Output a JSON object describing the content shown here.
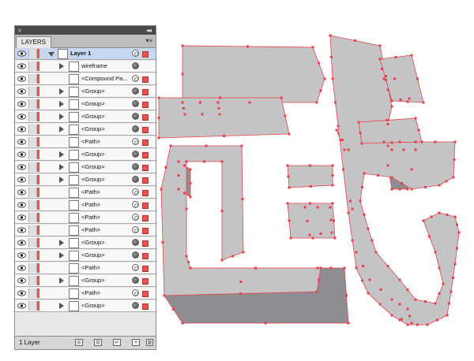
{
  "panel": {
    "tab_label": "LAYERS",
    "menu_icon": "panel-menu-icon",
    "collapse_label": "◂◂",
    "close_label": "x",
    "footer_count": "1 Layer"
  },
  "layers": [
    {
      "label": "Layer 1",
      "level": 0,
      "expand": "down",
      "selected": true,
      "target": "ring",
      "square": "filled"
    },
    {
      "label": "wireframe",
      "level": 1,
      "expand": "right",
      "selected": false,
      "target": "filled",
      "square": "none"
    },
    {
      "label": "<Compound Pa...",
      "level": 1,
      "expand": "none",
      "selected": false,
      "target": "ring",
      "square": "filled"
    },
    {
      "label": "<Group>",
      "level": 1,
      "expand": "right",
      "selected": false,
      "target": "filled",
      "square": "filled"
    },
    {
      "label": "<Group>",
      "level": 1,
      "expand": "right",
      "selected": false,
      "target": "filled",
      "square": "filled"
    },
    {
      "label": "<Group>",
      "level": 1,
      "expand": "right",
      "selected": false,
      "target": "filled",
      "square": "filled"
    },
    {
      "label": "<Group>",
      "level": 1,
      "expand": "right",
      "selected": false,
      "target": "filled",
      "square": "filled"
    },
    {
      "label": "<Path>",
      "level": 1,
      "expand": "none",
      "selected": false,
      "target": "ring",
      "square": "filled"
    },
    {
      "label": "<Group>",
      "level": 1,
      "expand": "right",
      "selected": false,
      "target": "filled",
      "square": "filled"
    },
    {
      "label": "<Group>",
      "level": 1,
      "expand": "right",
      "selected": false,
      "target": "filled",
      "square": "filled"
    },
    {
      "label": "<Group>",
      "level": 1,
      "expand": "right",
      "selected": false,
      "target": "filled",
      "square": "filled"
    },
    {
      "label": "<Path>",
      "level": 1,
      "expand": "none",
      "selected": false,
      "target": "ring",
      "square": "filled"
    },
    {
      "label": "<Path>",
      "level": 1,
      "expand": "none",
      "selected": false,
      "target": "ring",
      "square": "filled"
    },
    {
      "label": "<Path>",
      "level": 1,
      "expand": "none",
      "selected": false,
      "target": "ring",
      "square": "filled"
    },
    {
      "label": "<Path>",
      "level": 1,
      "expand": "none",
      "selected": false,
      "target": "ring",
      "square": "filled"
    },
    {
      "label": "<Group>",
      "level": 1,
      "expand": "right",
      "selected": false,
      "target": "filled",
      "square": "filled"
    },
    {
      "label": "<Group>",
      "level": 1,
      "expand": "right",
      "selected": false,
      "target": "filled",
      "square": "filled"
    },
    {
      "label": "<Path>",
      "level": 1,
      "expand": "none",
      "selected": false,
      "target": "ring",
      "square": "filled"
    },
    {
      "label": "<Group>",
      "level": 1,
      "expand": "right",
      "selected": false,
      "target": "filled",
      "square": "filled"
    },
    {
      "label": "<Path>",
      "level": 1,
      "expand": "none",
      "selected": false,
      "target": "ring",
      "square": "filled"
    },
    {
      "label": "<Group>",
      "level": 1,
      "expand": "right",
      "selected": false,
      "target": "filled",
      "square": "filled"
    }
  ],
  "footer_buttons": [
    "locate-object-icon",
    "make-clipping-mask-icon",
    "new-sublayer-icon",
    "new-layer-icon",
    "trash-icon"
  ],
  "colors": {
    "layer_color": "#f0524f",
    "selection": "#c7d7ef",
    "shape_face": "#c4c4c6",
    "shape_side": "#8e8e92",
    "anchor": "#e8414a"
  }
}
